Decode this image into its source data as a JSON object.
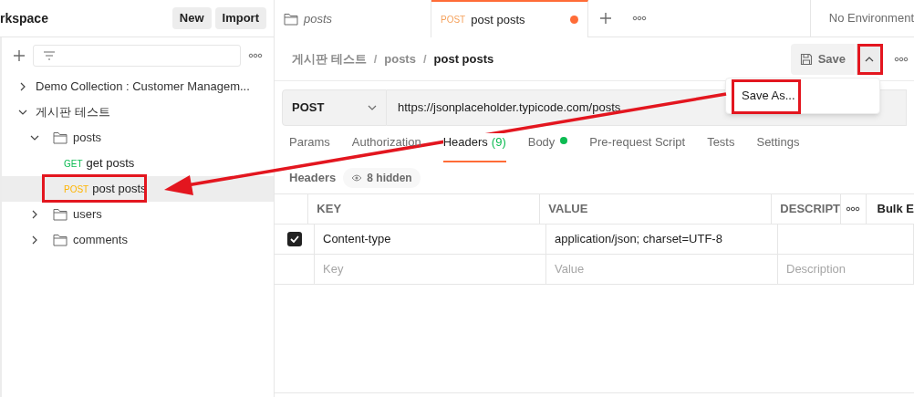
{
  "sidebar": {
    "workspace_title": "rkspace",
    "buttons": [
      "New",
      "Import"
    ],
    "tree": [
      {
        "kind": "collection",
        "label": "Demo Collection : Customer Managem...",
        "expanded": false,
        "selected": false
      },
      {
        "kind": "collection",
        "label": "게시판 테스트",
        "expanded": true,
        "selected": false,
        "children": [
          {
            "kind": "folder",
            "label": "posts",
            "expanded": true,
            "selected": false,
            "children": [
              {
                "kind": "request",
                "method": "GET",
                "label": "get posts",
                "selected": false
              },
              {
                "kind": "request",
                "method": "POST",
                "label": "post posts",
                "selected": true
              }
            ]
          },
          {
            "kind": "folder",
            "label": "users",
            "expanded": false,
            "selected": false
          },
          {
            "kind": "folder",
            "label": "comments",
            "expanded": false,
            "selected": false
          }
        ]
      }
    ]
  },
  "tabs": [
    {
      "kind": "folder",
      "label": "posts",
      "selected": false,
      "unsaved": false
    },
    {
      "kind": "request",
      "method": "POST",
      "label": "post posts",
      "selected": true,
      "unsaved": true
    }
  ],
  "environment": "No Environment",
  "breadcrumb": [
    {
      "kind": "link",
      "label": "게시판 테스트"
    },
    {
      "kind": "separator",
      "label": "/"
    },
    {
      "kind": "link",
      "label": "posts"
    },
    {
      "kind": "separator",
      "label": "/"
    },
    {
      "kind": "current",
      "label": "post posts"
    }
  ],
  "save_button": "Save",
  "save_menu": {
    "items": [
      "Save As..."
    ]
  },
  "request": {
    "method": "POST",
    "url": "https://jsonplaceholder.typicode.com/posts"
  },
  "request_tabs": [
    {
      "label": "Params",
      "selected": false,
      "dot": false
    },
    {
      "label": "Authorization",
      "selected": false,
      "dot": false
    },
    {
      "label": "Headers",
      "count": "(9)",
      "selected": true,
      "dot": false
    },
    {
      "label": "Body",
      "selected": false,
      "dot": true
    },
    {
      "label": "Pre-request Script",
      "selected": false,
      "dot": false
    },
    {
      "label": "Tests",
      "selected": false,
      "dot": false
    },
    {
      "label": "Settings",
      "selected": false,
      "dot": false
    }
  ],
  "headers": {
    "title": "Headers",
    "hidden_badge": "8 hidden",
    "columns": [
      "KEY",
      "VALUE",
      "DESCRIPT"
    ],
    "bulk_edit": "Bulk E",
    "rows": [
      {
        "checked": true,
        "key": "Content-type",
        "value": "application/json; charset=UTF-8",
        "description": ""
      }
    ],
    "placeholder_row": {
      "key": "Key",
      "value": "Value",
      "description": "Description"
    }
  }
}
